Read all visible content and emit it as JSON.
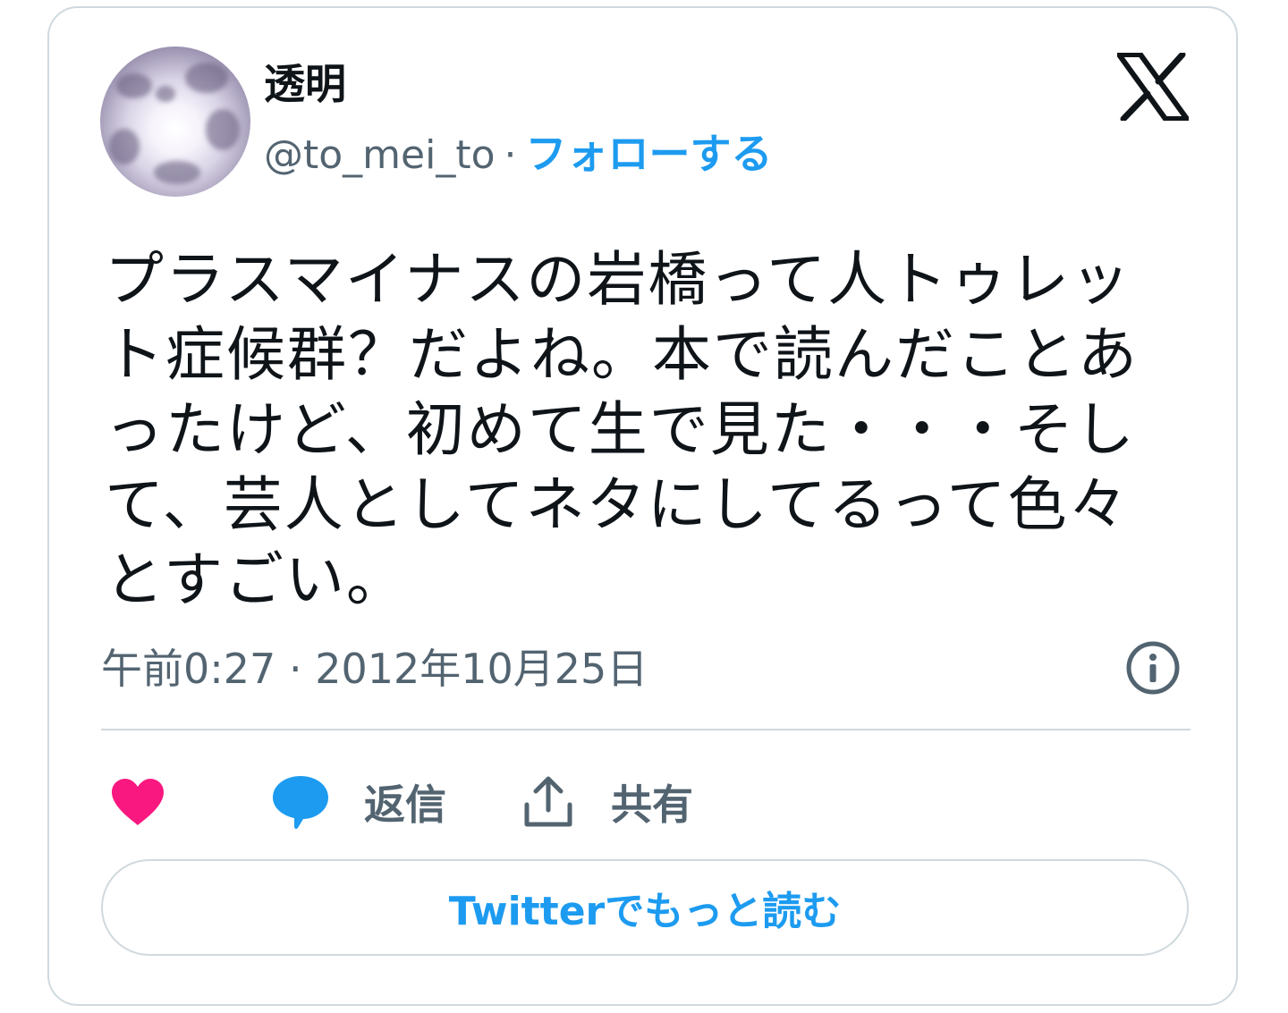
{
  "author": {
    "display_name": "透明",
    "handle": "@to_mei_to",
    "separator": "·",
    "follow_label": "フォローする"
  },
  "brand": {
    "logo_icon": "x-logo-icon"
  },
  "tweet": {
    "text": "プラスマイナスの岩橋って人トゥレット症候群？だよね。本で読んだことあったけど、初めて生で見た・・・そして、芸人としてネタにしてるって色々とすごい。",
    "time": "午前0:27",
    "meta_separator": "·",
    "date": "2012年10月25日"
  },
  "actions": {
    "like_icon": "heart-icon",
    "reply_icon": "speech-bubble-icon",
    "reply_label": "返信",
    "share_icon": "share-upload-icon",
    "share_label": "共有"
  },
  "read_more_label": "Twitterでもっと読む",
  "colors": {
    "accent": "#1d9bf0",
    "like": "#f91880",
    "text": "#0f1419",
    "secondary": "#536471",
    "border": "#cfd9de"
  }
}
